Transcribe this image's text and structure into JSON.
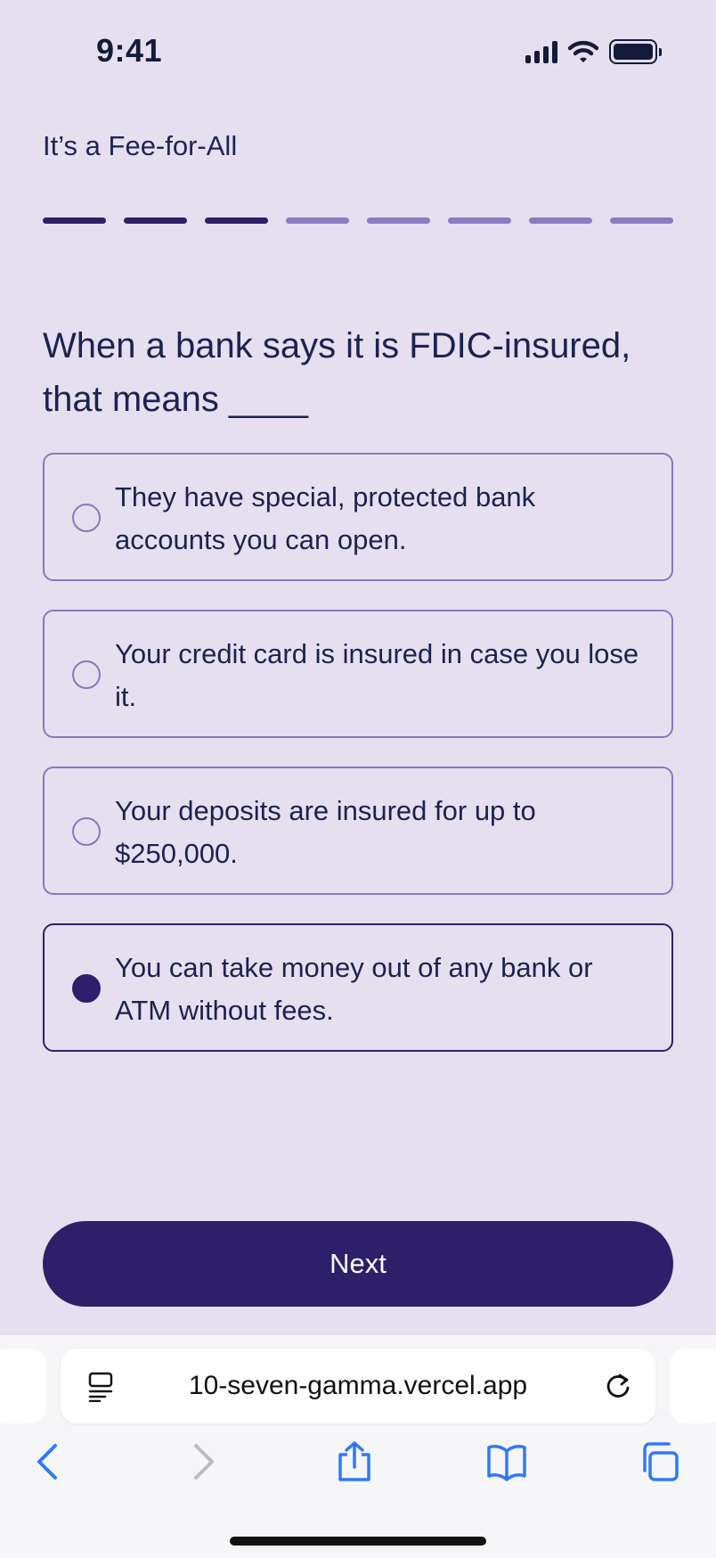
{
  "status_bar": {
    "time": "9:41"
  },
  "quiz": {
    "title": "It’s a Fee-for-All",
    "progress": {
      "total_steps": 8,
      "completed_steps": 3
    },
    "question": "When a bank says it is FDIC-insured, that means ____",
    "options": [
      {
        "text": "They have special, protected bank accounts you can open.",
        "selected": false
      },
      {
        "text": "Your credit card is insured in case you lose it.",
        "selected": false
      },
      {
        "text": "Your deposits are insured for up to $250,000.",
        "selected": false
      },
      {
        "text": "You can take money out of any bank or ATM without fees.",
        "selected": true
      }
    ],
    "next_label": "Next"
  },
  "browser": {
    "url": "10-seven-gamma.vercel.app"
  },
  "colors": {
    "background": "#e6dff0",
    "accent": "#2d1f6a",
    "progress_inactive": "#8c7bc2",
    "option_border": "#8778bf",
    "browser_icon": "#2f7af6"
  }
}
